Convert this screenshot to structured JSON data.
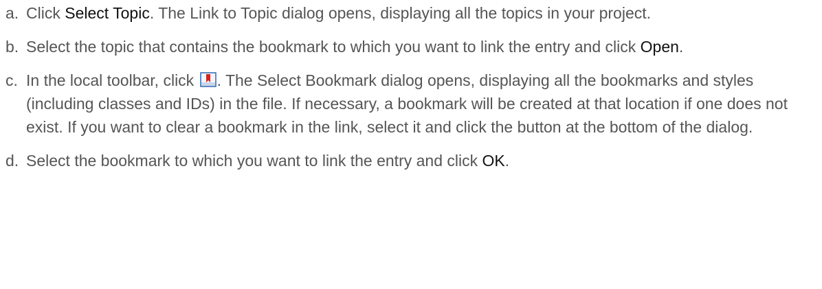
{
  "steps": [
    {
      "marker": "a.",
      "parts": {
        "t1": "Click ",
        "b1": "Select Topic",
        "t2": ". The Link to Topic dialog opens, displaying all the topics in your project."
      }
    },
    {
      "marker": "b.",
      "parts": {
        "t1": "Select the topic that contains the bookmark to which you want to link the entry and click ",
        "b1": "Open",
        "t2": "."
      }
    },
    {
      "marker": "c.",
      "parts": {
        "t1": "In the local toolbar, click ",
        "icon": "bookmark-icon",
        "t2": ". The Select Bookmark dialog opens, displaying all the bookmarks and styles (including classes and IDs) in the file. If necessary, a bookmark will be created at that location if one does not exist. If you want to clear a bookmark in the link, select it and click the button at the bottom of the dialog."
      }
    },
    {
      "marker": "d.",
      "parts": {
        "t1": "Select the bookmark to which you want to link the entry and click ",
        "b1": "OK",
        "t2": "."
      }
    }
  ],
  "colors": {
    "body_text": "#555555",
    "emphasis_text": "#111111",
    "icon_red": "#d9221c",
    "icon_blue": "#2f66b3"
  }
}
